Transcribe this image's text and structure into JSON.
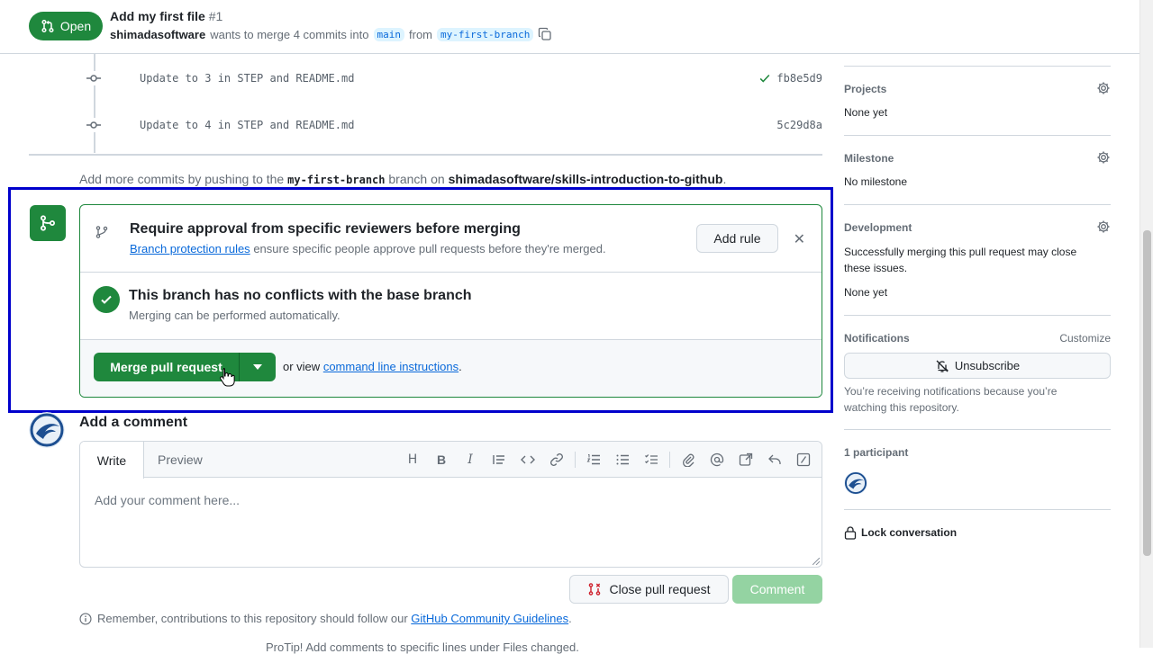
{
  "header": {
    "state": "Open",
    "title": "Add my first file",
    "number": "#1",
    "author": "shimadasoftware",
    "merge_text": "wants to merge 4 commits into",
    "base_branch": "main",
    "from_text": "from",
    "head_branch": "my-first-branch"
  },
  "commits": [
    {
      "message": "Update to 3 in STEP and README.md",
      "sha": "fb8e5d9",
      "verified": true
    },
    {
      "message": "Update to 4 in STEP and README.md",
      "sha": "5c29d8a",
      "verified": false
    }
  ],
  "push_note": {
    "prefix": "Add more commits by pushing to the",
    "branch": "my-first-branch",
    "middle": "branch on",
    "repo": "shimadasoftware/skills-introduction-to-github",
    "suffix": "."
  },
  "merge_box": {
    "rule_title": "Require approval from specific reviewers before merging",
    "rule_link": "Branch protection rules",
    "rule_desc": "ensure specific people approve pull requests before they're merged.",
    "add_rule_label": "Add rule",
    "status_title": "This branch has no conflicts with the base branch",
    "status_desc": "Merging can be performed automatically.",
    "merge_label": "Merge pull request",
    "or_view": "or view",
    "cli_link": "command line instructions",
    "cli_suffix": "."
  },
  "comment": {
    "heading": "Add a comment",
    "tab_write": "Write",
    "tab_preview": "Preview",
    "placeholder": "Add your comment here...",
    "close_label": "Close pull request",
    "comment_label": "Comment",
    "guidelines_prefix": "Remember, contributions to this repository should follow our",
    "guidelines_link": "GitHub Community Guidelines",
    "guidelines_suffix": ".",
    "cut_text": "ProTip! Add comments to specific lines under Files changed."
  },
  "sidebar": {
    "projects_label": "Projects",
    "projects_value": "None yet",
    "milestone_label": "Milestone",
    "milestone_value": "No milestone",
    "development_label": "Development",
    "development_desc": "Successfully merging this pull request may close these issues.",
    "development_value": "None yet",
    "notifications_label": "Notifications",
    "customize_label": "Customize",
    "unsubscribe_label": "Unsubscribe",
    "notifications_desc": "You’re receiving notifications because you’re watching this repository.",
    "participants_label": "1 participant",
    "lock_label": "Lock conversation"
  },
  "colors": {
    "accent_green": "#1f883d",
    "link_blue": "#0969da",
    "highlight_border": "#0000cc"
  }
}
